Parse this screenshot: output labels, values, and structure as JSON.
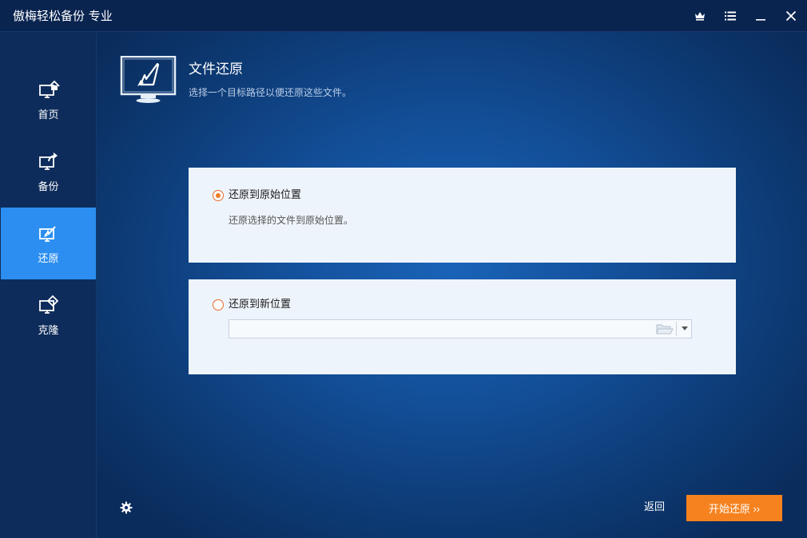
{
  "window": {
    "title": "傲梅轻松备份 专业"
  },
  "titlebar": {
    "buttons": [
      {
        "icon": "crown-icon"
      },
      {
        "icon": "menu-icon"
      },
      {
        "icon": "minimize-icon"
      },
      {
        "icon": "close-icon"
      }
    ]
  },
  "sidebar": {
    "items": [
      {
        "label": "首页",
        "icon": "home-icon"
      },
      {
        "label": "备份",
        "icon": "backup-icon"
      },
      {
        "label": "还原",
        "icon": "restore-icon",
        "active": true
      },
      {
        "label": "克隆",
        "icon": "clone-icon"
      }
    ]
  },
  "header": {
    "title": "文件还原",
    "subtitle": "选择一个目标路径以便还原这些文件。"
  },
  "options": {
    "original": {
      "label": "还原到原始位置",
      "description": "还原选择的文件到原始位置。",
      "checked": true
    },
    "new": {
      "label": "还原到新位置",
      "path_value": "",
      "checked": false
    }
  },
  "footer": {
    "back_label": "返回",
    "start_label": "开始还原 ››"
  },
  "colors": {
    "accent": "#f5821f",
    "sidebar_active": "#2b8ef0",
    "titlebar": "#0a2450"
  }
}
